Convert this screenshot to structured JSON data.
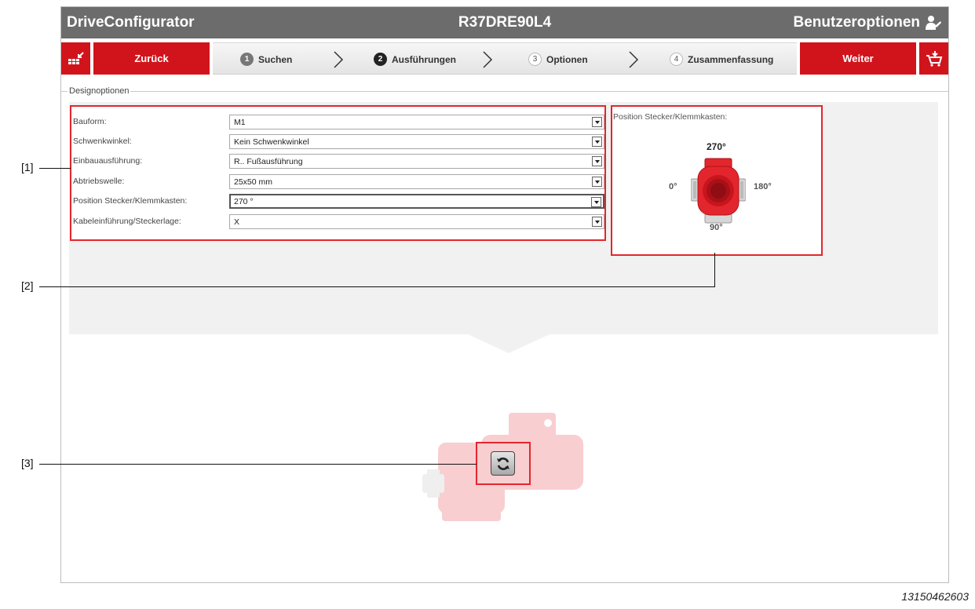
{
  "titlebar": {
    "app_name": "DriveConfigurator",
    "product_code": "R37DRE90L4",
    "user_options": "Benutzeroptionen",
    "user_icon": "user-settings-icon"
  },
  "nav": {
    "back_label": "Zurück",
    "next_label": "Weiter",
    "steps": [
      {
        "num": "1",
        "label": "Suchen",
        "state": "done"
      },
      {
        "num": "2",
        "label": "Ausführungen",
        "state": "active"
      },
      {
        "num": "3",
        "label": "Optionen",
        "state": "inactive"
      },
      {
        "num": "4",
        "label": "Zusammenfassung",
        "state": "inactive"
      }
    ]
  },
  "design": {
    "group_title": "Designoptionen",
    "fields": [
      {
        "label": "Bauform:",
        "value": "M1"
      },
      {
        "label": "Schwenkwinkel:",
        "value": "Kein Schwenkwinkel"
      },
      {
        "label": "Einbauausführung:",
        "value": "R.. Fußausführung"
      },
      {
        "label": "Abtriebswelle:",
        "value": "25x50 mm"
      },
      {
        "label": "Position Stecker/Klemmkasten:",
        "value": "270 °"
      },
      {
        "label": "Kabeleinführung/Steckerlage:",
        "value": "X"
      }
    ]
  },
  "position_panel": {
    "title": "Position Stecker/Klemmkasten:",
    "deg_top": "270°",
    "deg_left": "0°",
    "deg_right": "180°",
    "deg_bottom": "90°"
  },
  "callouts": {
    "c1": "[1]",
    "c2": "[2]",
    "c3": "[3]"
  },
  "figure_id": "13150462603",
  "colors": {
    "accent_red": "#d1141c",
    "highlight_red": "#e3262d",
    "titlebar_grey": "#6c6c6c"
  }
}
